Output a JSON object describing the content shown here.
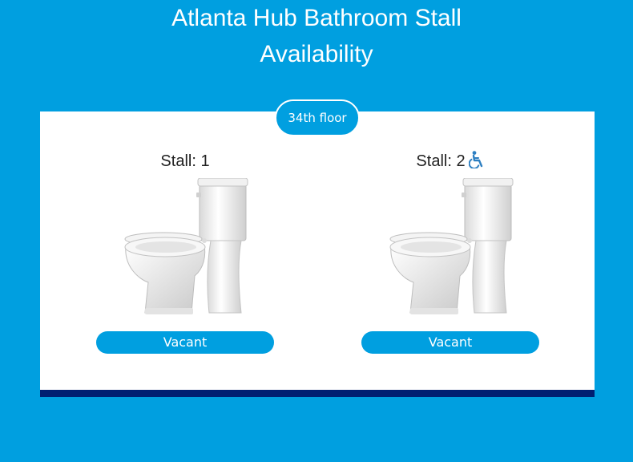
{
  "page": {
    "title_line1": "Atlanta Hub Bathroom Stall",
    "title_line2": "Availability"
  },
  "floor": {
    "label": "34th floor"
  },
  "stalls": [
    {
      "label": "Stall: 1",
      "accessible": false,
      "image_icon": "toilet-icon",
      "status": "Vacant"
    },
    {
      "label": "Stall: 2",
      "accessible": true,
      "accessibility_icon": "wheelchair-icon",
      "image_icon": "toilet-icon",
      "status": "Vacant"
    }
  ],
  "colors": {
    "background": "#009fe0",
    "card": "#ffffff",
    "card_bar": "#001f72",
    "status_vacant": "#009fe0",
    "accessibility_icon": "#2d7fc1"
  }
}
